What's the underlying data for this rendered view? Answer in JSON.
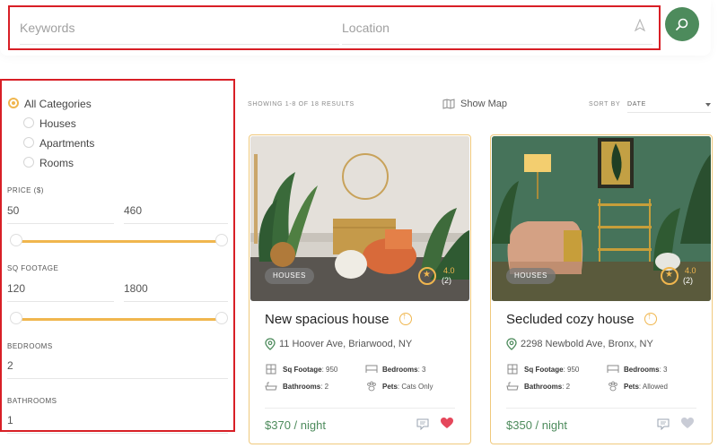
{
  "search": {
    "keywords_placeholder": "Keywords",
    "keywords_value": "",
    "location_placeholder": "Location",
    "location_value": "",
    "location_icon": "locate-arrow-icon",
    "search_icon": "search-icon",
    "accent": "#d81f26",
    "button_color": "#4d8b5c"
  },
  "filters": {
    "categories": [
      {
        "label": "All Categories",
        "checked": true
      },
      {
        "label": "Houses",
        "checked": false
      },
      {
        "label": "Apartments",
        "checked": false
      },
      {
        "label": "Rooms",
        "checked": false
      }
    ],
    "price": {
      "label": "PRICE ($)",
      "min": "50",
      "max": "460"
    },
    "sq_footage": {
      "label": "SQ FOOTAGE",
      "min": "120",
      "max": "1800"
    },
    "bedrooms": {
      "label": "BEDROOMS",
      "value": "2"
    },
    "bathrooms": {
      "label": "BATHROOMS",
      "value": "1"
    },
    "slider_color": "#f0b64e"
  },
  "results": {
    "summary": "SHOWING 1-8 OF 18 RESULTS",
    "show_map": "Show Map",
    "sort_label": "SORT BY",
    "sort_value": "DATE"
  },
  "listings": [
    {
      "category": "HOUSES",
      "rating": "4.0",
      "rating_count": "(2)",
      "title": "New spacious house",
      "address": "11 Hoover Ave, Briarwood, NY",
      "sq_footage_label": "Sq Footage",
      "sq_footage": ": 950",
      "bedrooms_label": "Bedrooms",
      "bedrooms": ": 3",
      "bathrooms_label": "Bathrooms",
      "bathrooms": ": 2",
      "pets_label": "Pets",
      "pets": ": Cats Only",
      "price": "$370 / night",
      "favorited": true
    },
    {
      "category": "HOUSES",
      "rating": "4.0",
      "rating_count": "(2)",
      "title": "Secluded cozy house",
      "address": "2298 Newbold Ave, Bronx, NY",
      "sq_footage_label": "Sq Footage",
      "sq_footage": ": 950",
      "bedrooms_label": "Bedrooms",
      "bedrooms": ": 3",
      "bathrooms_label": "Bathrooms",
      "bathrooms": ": 2",
      "pets_label": "Pets",
      "pets": ": Allowed",
      "price": "$350 / night",
      "favorited": false
    }
  ],
  "colors": {
    "price_green": "#4d8b5c",
    "heart_active": "#e5475b",
    "heart_inactive": "#c9ccd6",
    "card_border": "#f0c97c"
  }
}
